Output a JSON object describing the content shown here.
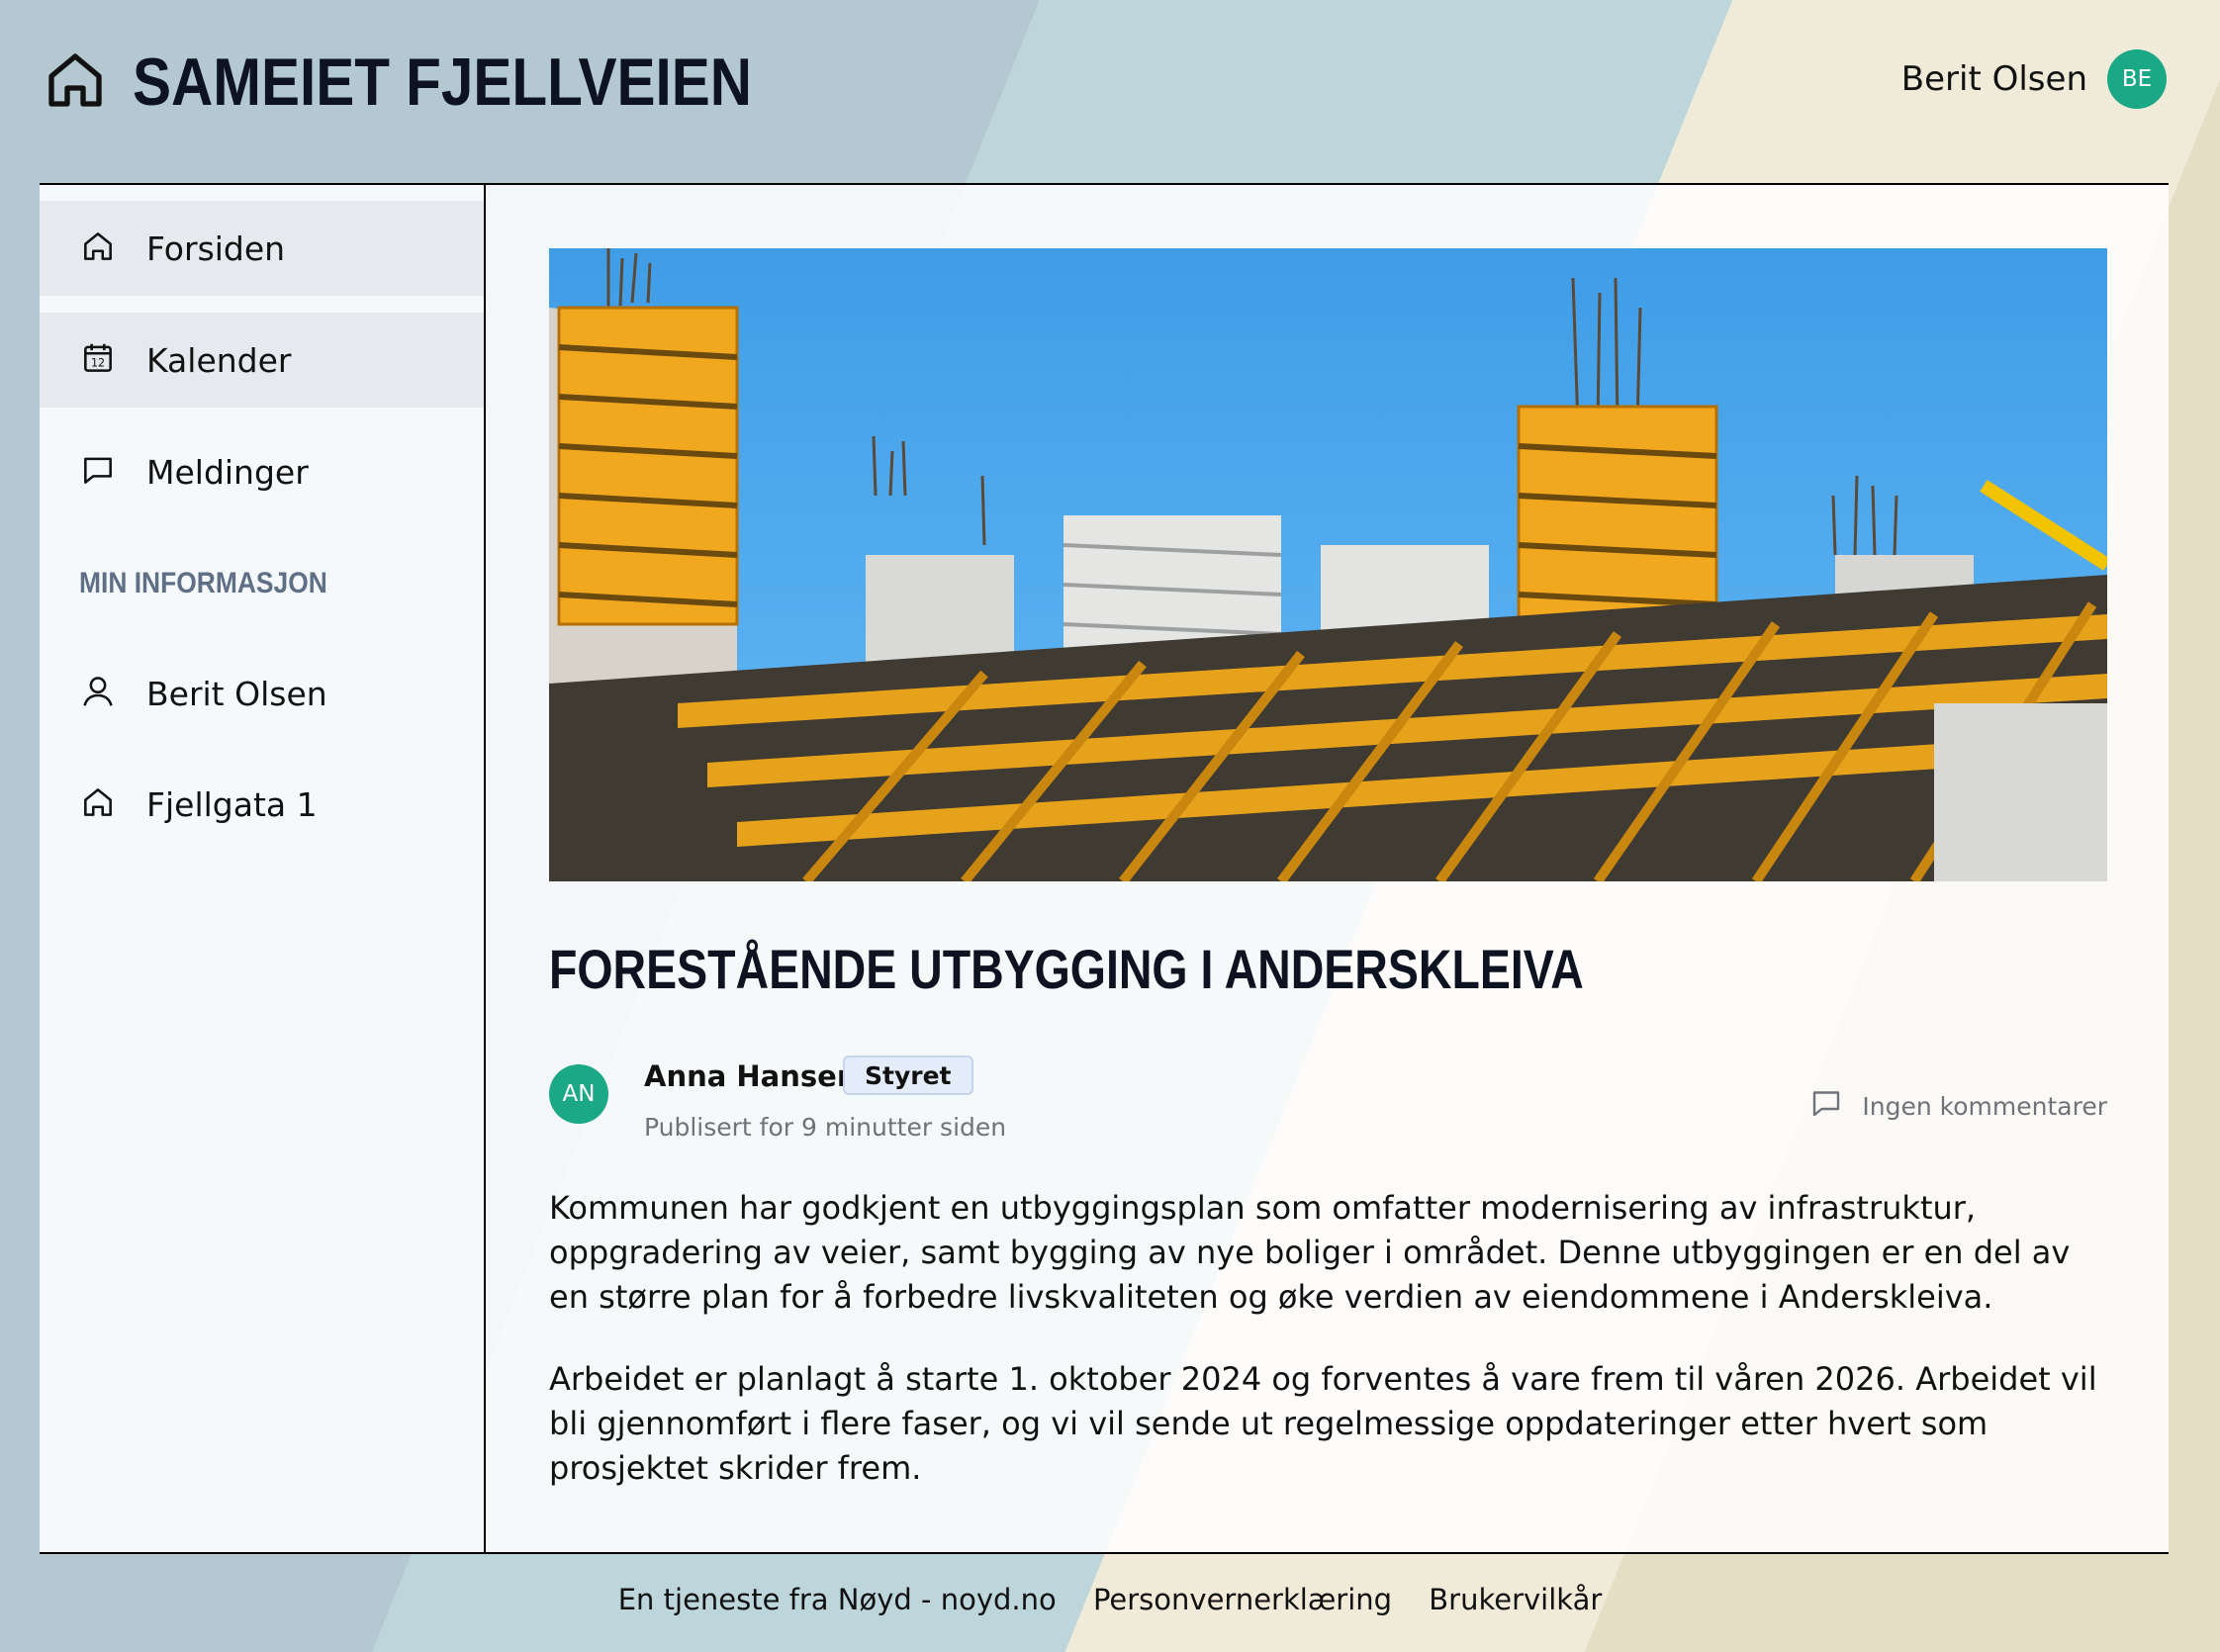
{
  "header": {
    "title": "SAMEIET FJELLVEIEN",
    "user_name": "Berit Olsen",
    "user_initials": "BE",
    "avatar_color": "#1aa887"
  },
  "sidebar": {
    "items": [
      {
        "label": "Forsiden",
        "icon": "home-icon",
        "active": true
      },
      {
        "label": "Kalender",
        "icon": "calendar-icon",
        "active": true
      },
      {
        "label": "Meldinger",
        "icon": "message-icon",
        "active": false
      }
    ],
    "section_title": "MIN INFORMASJON",
    "info_items": [
      {
        "label": "Berit Olsen",
        "icon": "user-icon"
      },
      {
        "label": "Fjellgata 1",
        "icon": "home-icon"
      }
    ]
  },
  "post": {
    "title": "FORESTÅENDE UTBYGGING I ANDERSKLEIVA",
    "author_initials": "AN",
    "author_name": "Anna Hansen",
    "badge": "Styret",
    "published": "Publisert for 9 minutter siden",
    "comments": "Ingen kommentarer",
    "paragraphs": [
      "Kommunen har godkjent en utbyggingsplan som omfatter modernisering av infrastruktur, oppgradering av veier, samt bygging av nye boliger i området. Denne utbyggingen er en del av en større plan for å forbedre livskvaliteten og øke verdien av eiendommene i Anderskleiva.",
      "Arbeidet er planlagt å starte 1. oktober 2024 og forventes å vare frem til våren 2026. Arbeidet vil bli gjennomført i flere faser, og vi vil sende ut regelmessige oppdateringer etter hvert som prosjektet skrider frem."
    ]
  },
  "footer": {
    "links": [
      "En tjeneste fra Nøyd - noyd.no",
      "Personvernerklæring",
      "Brukervilkår"
    ]
  }
}
